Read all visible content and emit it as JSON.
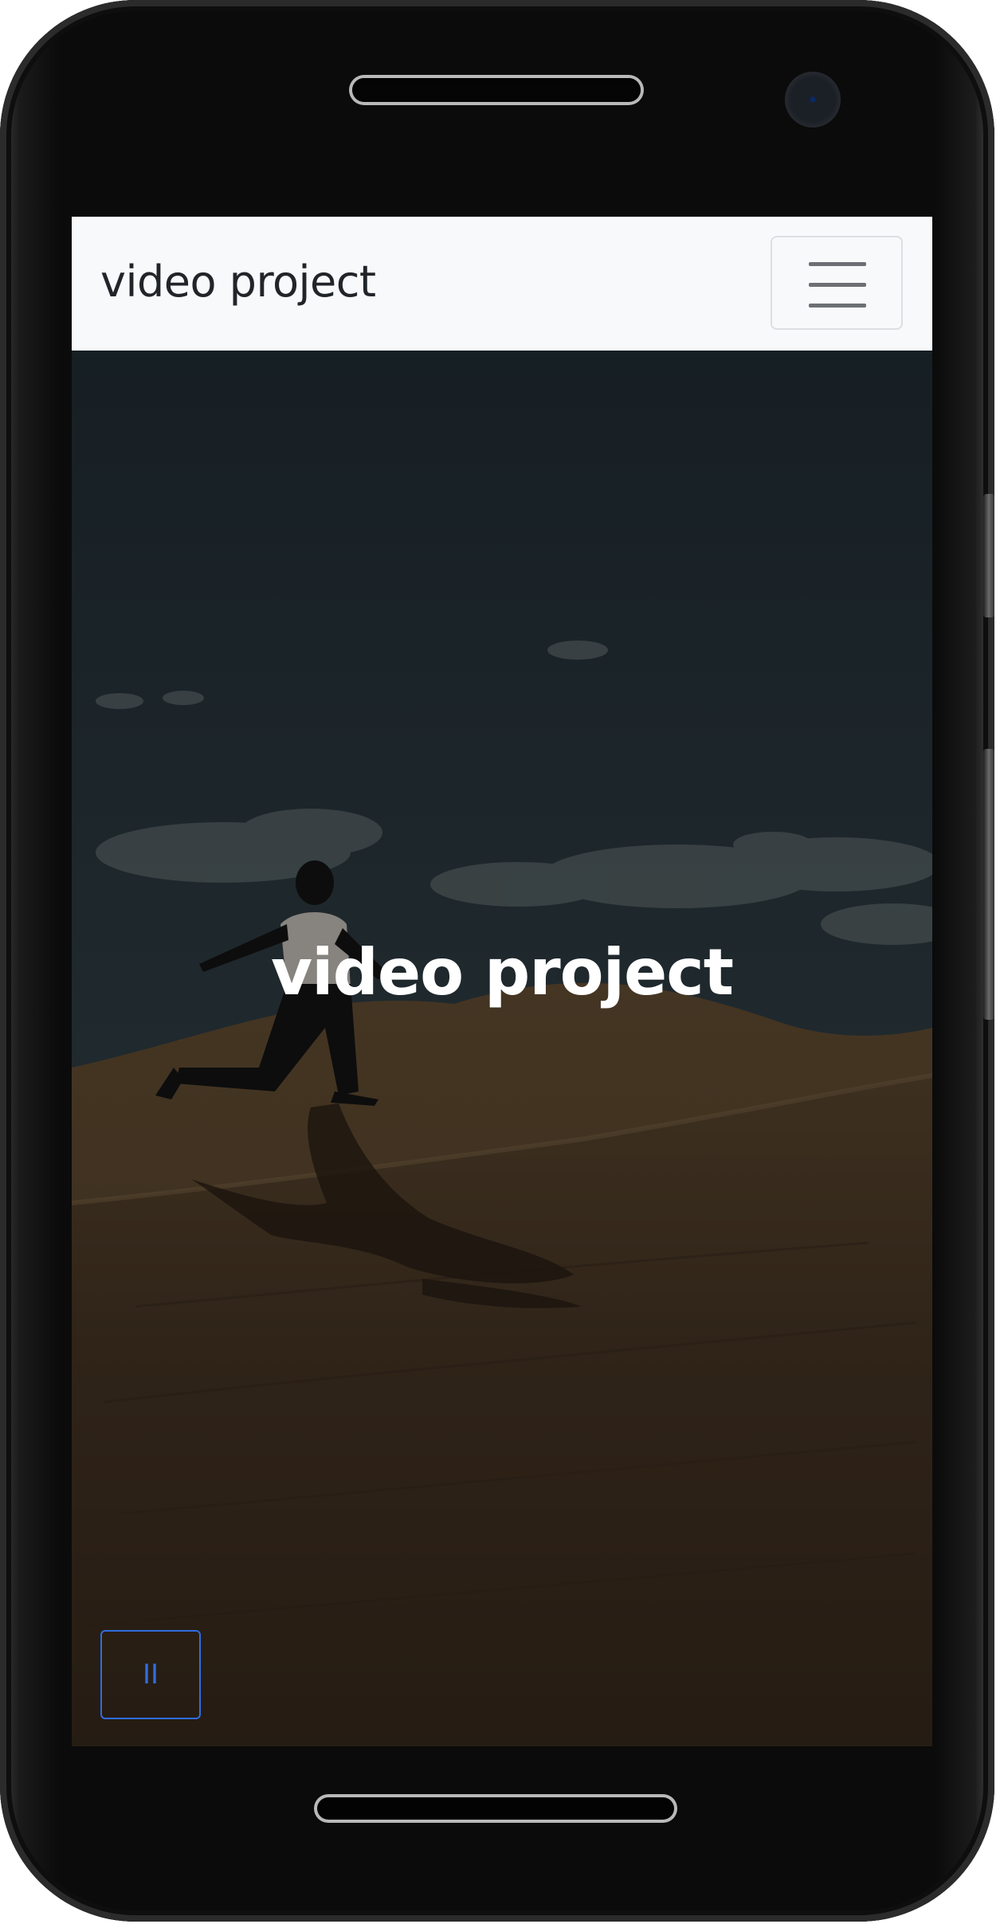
{
  "navbar": {
    "brand": "video project",
    "toggler_icon": "hamburger-menu-icon"
  },
  "hero": {
    "title": "video project",
    "background": "desert dune runner video frame",
    "overlay_color": "#000000"
  },
  "controls": {
    "pause_label": "II",
    "pause_icon": "pause-icon",
    "accent_color": "#2f6de0"
  },
  "device": {
    "frame_color": "#0b0b0b"
  }
}
